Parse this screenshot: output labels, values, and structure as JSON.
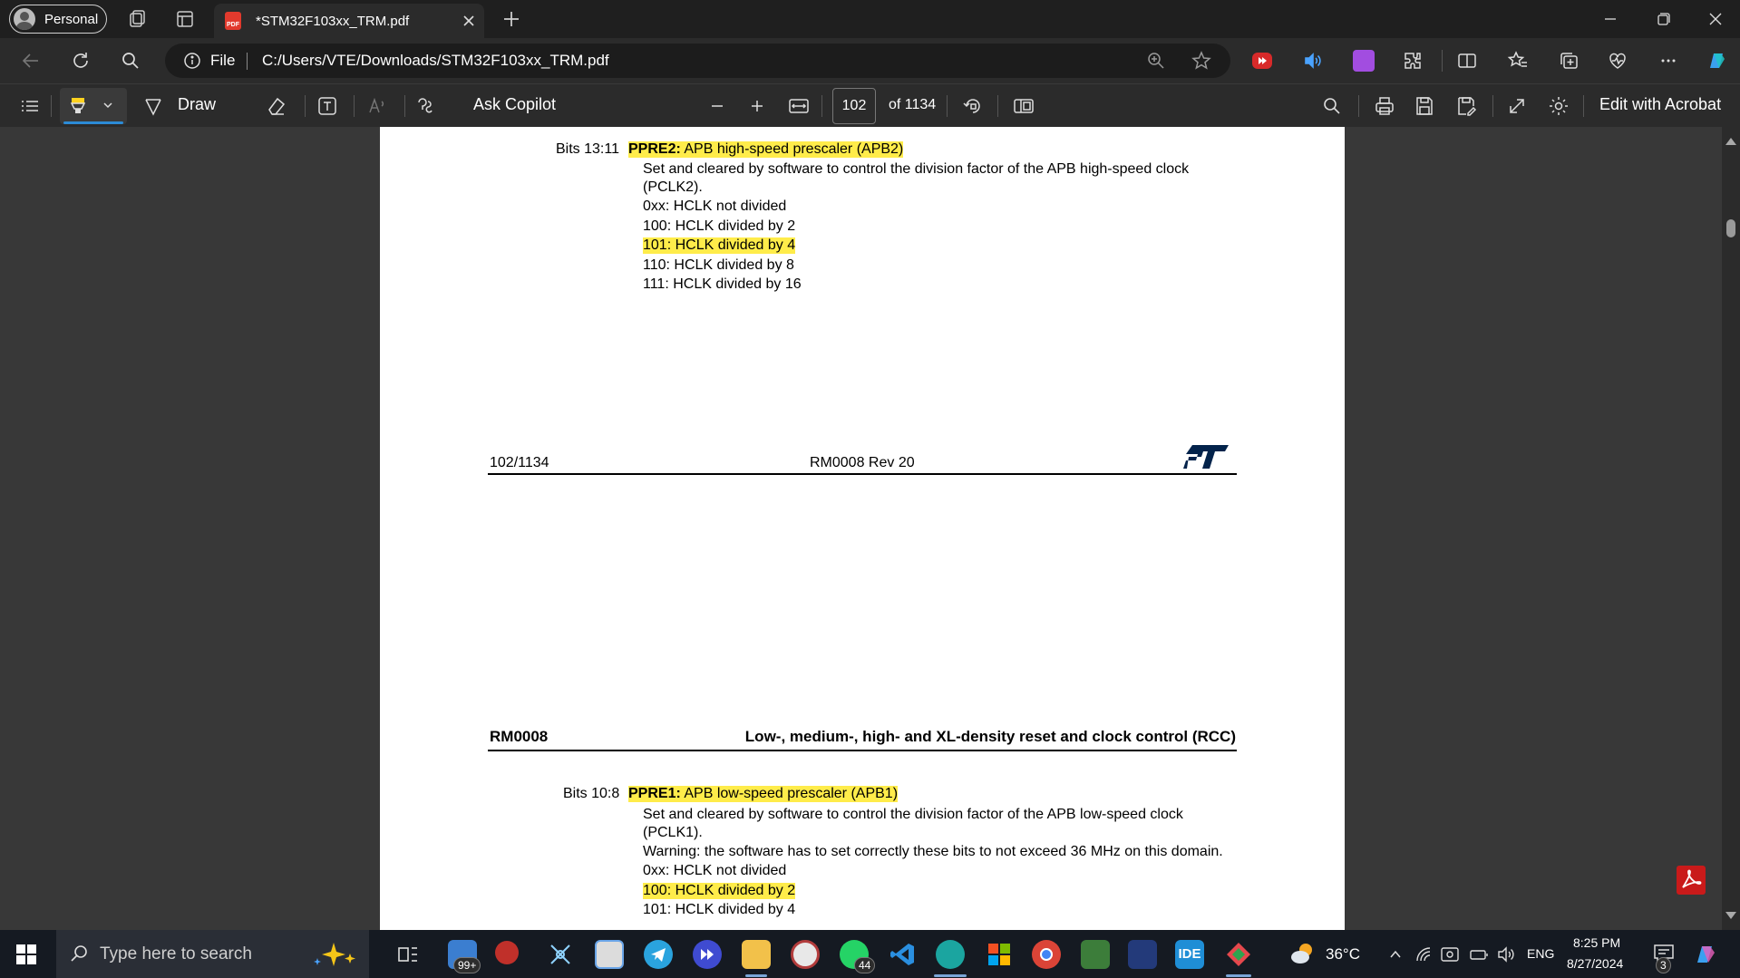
{
  "browser": {
    "profile_label": "Personal",
    "tab_title": "*STM32F103xx_TRM.pdf",
    "address_scheme": "File",
    "address_url": "C:/Users/VTE/Downloads/STM32F103xx_TRM.pdf"
  },
  "pdf_toolbar": {
    "draw_label": "Draw",
    "ask_copilot_label": "Ask Copilot",
    "current_page": "102",
    "total_pages_label": "of 1134",
    "edit_acrobat_label": "Edit with Acrobat"
  },
  "page1": {
    "bits_label": "Bits 13:11",
    "field_name": "PPRE2:",
    "field_title": " APB high-speed prescaler (APB2)",
    "desc_line1": "Set and cleared by software to control the division factor of the APB high-speed clock",
    "desc_line2": "(PCLK2).",
    "values": [
      "0xx: HCLK not divided",
      "100: HCLK divided by 2",
      "101: HCLK divided by 4",
      "110: HCLK divided by 8",
      "111: HCLK divided by 16"
    ],
    "footer_page": "102/1134",
    "footer_doc": "RM0008 Rev 20"
  },
  "page2": {
    "header_left": "RM0008",
    "header_right": "Low-, medium-, high- and XL-density reset and clock control (RCC)",
    "bits_label": "Bits 10:8",
    "field_name": "PPRE1:",
    "field_title": " APB low-speed prescaler (APB1)",
    "desc_line1": "Set and cleared by software to control the division factor of the APB low-speed clock",
    "desc_line2": "(PCLK1).",
    "warning": "Warning: the software has to set correctly these bits to not exceed 36 MHz on this domain.",
    "values": [
      "0xx: HCLK not divided",
      "100: HCLK divided by 2",
      "101: HCLK divided by 4"
    ]
  },
  "taskbar": {
    "search_placeholder": "Type here to search",
    "mail_badge": "99+",
    "whatsapp_badge": "44",
    "ide_label": "IDE",
    "weather_temp": "36°C",
    "language": "ENG",
    "time": "8:25 PM",
    "date": "8/27/2024",
    "notif_count": "3"
  },
  "colors": {
    "highlight": "#ffec4a",
    "accent": "#2c8bd6",
    "st_logo": "#03234b"
  }
}
